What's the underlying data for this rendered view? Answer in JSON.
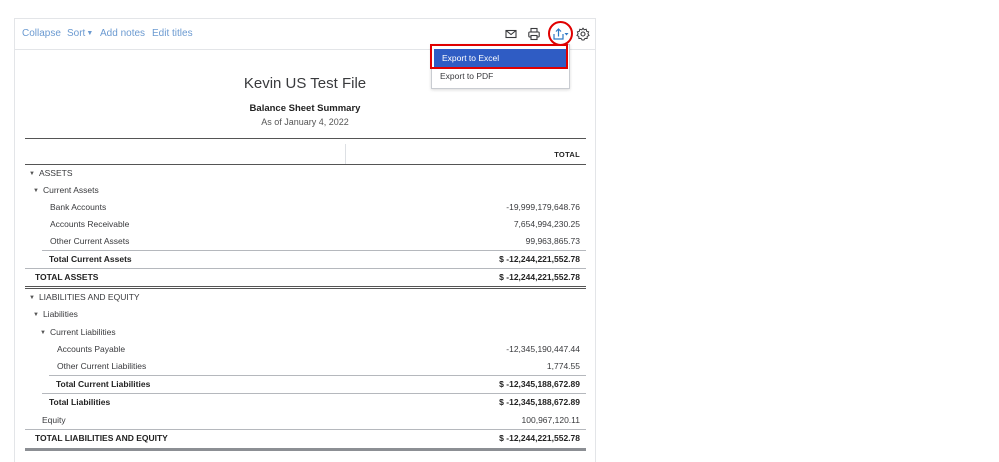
{
  "toolbar": {
    "collapse": "Collapse",
    "sort": "Sort",
    "add_notes": "Add notes",
    "edit_titles": "Edit titles",
    "icons": [
      "mail-icon",
      "print-icon",
      "export-icon",
      "gear-icon"
    ]
  },
  "export_menu": {
    "items": [
      "Export to Excel",
      "Export to PDF"
    ],
    "highlight_color": "#e00000",
    "active_bg": "#2f5cc4"
  },
  "report": {
    "company": "Kevin US Test File",
    "title": "Balance Sheet Summary",
    "date": "As of January 4, 2022",
    "column_header": "TOTAL"
  },
  "rows": [
    {
      "label": "ASSETS",
      "value": ""
    },
    {
      "label": "Current Assets",
      "value": ""
    },
    {
      "label": "Bank Accounts",
      "value": "-19,999,179,648.76"
    },
    {
      "label": "Accounts Receivable",
      "value": "7,654,994,230.25"
    },
    {
      "label": "Other Current Assets",
      "value": "99,963,865.73"
    },
    {
      "label": "Total Current Assets",
      "value": "$ -12,244,221,552.78"
    },
    {
      "label": "TOTAL ASSETS",
      "value": "$ -12,244,221,552.78"
    },
    {
      "label": "LIABILITIES AND EQUITY",
      "value": ""
    },
    {
      "label": "Liabilities",
      "value": ""
    },
    {
      "label": "Current Liabilities",
      "value": ""
    },
    {
      "label": "Accounts Payable",
      "value": "-12,345,190,447.44"
    },
    {
      "label": "Other Current Liabilities",
      "value": "1,774.55"
    },
    {
      "label": "Total Current Liabilities",
      "value": "$ -12,345,188,672.89"
    },
    {
      "label": "Total Liabilities",
      "value": "$ -12,345,188,672.89"
    },
    {
      "label": "Equity",
      "value": "100,967,120.11"
    },
    {
      "label": "TOTAL LIABILITIES AND EQUITY",
      "value": "$ -12,244,221,552.78"
    }
  ]
}
